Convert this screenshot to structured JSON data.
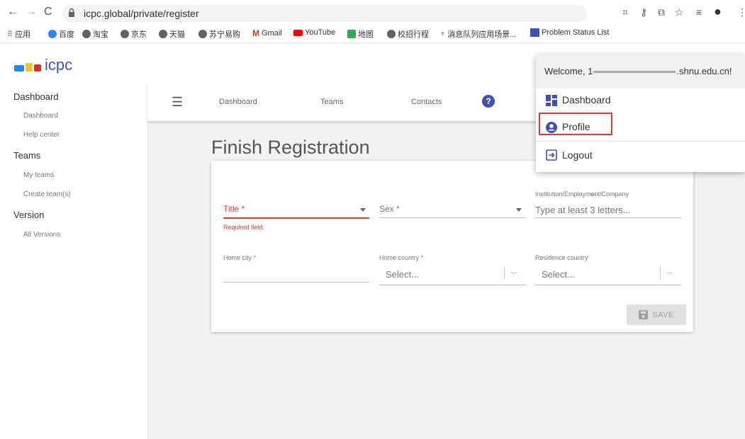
{
  "browser": {
    "url": "icpc.global/private/register",
    "bookmarks": [
      "应用",
      "百度",
      "淘宝",
      "京东",
      "天猫",
      "苏宁易购",
      "Gmail",
      "YouTube",
      "地图",
      "校招行程",
      "消息队列应用场景...",
      "Problem Status List"
    ]
  },
  "app": {
    "logo_text": "icpc"
  },
  "sidebar": {
    "sections": [
      {
        "title": "Dashboard",
        "items": [
          "Dashboard",
          "Help center"
        ]
      },
      {
        "title": "Teams",
        "items": [
          "My teams",
          "Create team(s)"
        ]
      },
      {
        "title": "Version",
        "items": [
          "All Versions"
        ]
      }
    ]
  },
  "topnav": {
    "links": [
      "Dashboard",
      "Teams",
      "Contacts"
    ]
  },
  "page": {
    "title": "Finish Registration"
  },
  "form": {
    "title_label": "Title *",
    "title_error": "Required field.",
    "sex_label": "Sex *",
    "institution_label": "Institution/Employment/Company",
    "institution_placeholder": "Type at least 3 letters...",
    "home_city_label": "Home city *",
    "home_country_label": "Home country *",
    "home_country_value": "Select...",
    "residence_country_label": "Residence country",
    "residence_country_value": "Select...",
    "save_label": "SAVE"
  },
  "user_menu": {
    "welcome_prefix": "Welcome, 1",
    "welcome_suffix": ".shnu.edu.cn!",
    "items": [
      "Dashboard",
      "Profile",
      "Logout"
    ]
  },
  "colors": {
    "accent": "#3f51b5",
    "error": "#e53935",
    "highlight": "#e53935"
  }
}
